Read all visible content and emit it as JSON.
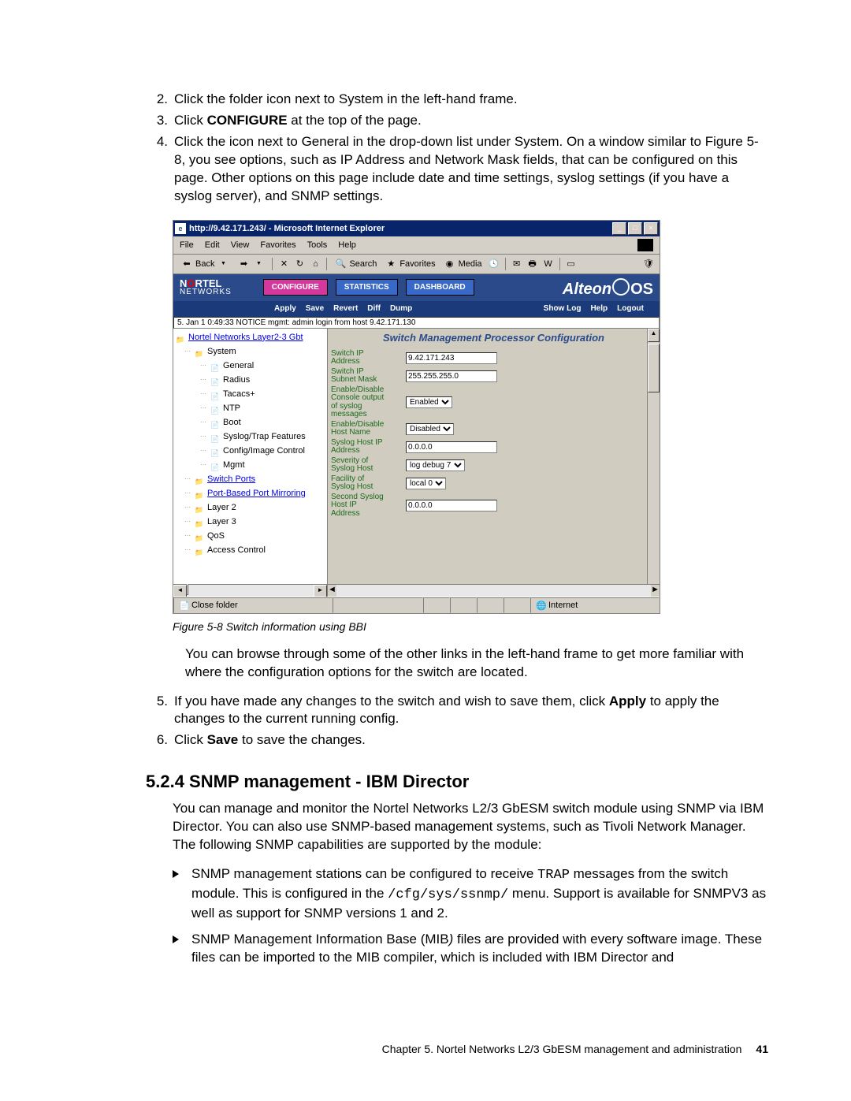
{
  "steps": {
    "s2": {
      "num": "2.",
      "txt": "Click the folder icon next to System in the left-hand frame."
    },
    "s3": {
      "num": "3.",
      "pre": "Click ",
      "bold": "CONFIGURE",
      "post": " at the top of the page."
    },
    "s4": {
      "num": "4.",
      "txt": "Click the icon next to General in the drop-down list under System. On a window similar to Figure 5-8, you see options, such as IP Address and Network Mask fields, that can be configured on this page. Other options on this page include date and time settings, syslog settings (if you have a syslog server), and SNMP settings."
    },
    "s5": {
      "num": "5.",
      "pre": "If you have made any changes to the switch and wish to save them, click ",
      "bold": "Apply",
      "post": " to apply the changes to the current running config."
    },
    "s6": {
      "num": "6.",
      "pre": "Click ",
      "bold": "Save",
      "post": " to save the changes."
    }
  },
  "browser": {
    "title": "http://9.42.171.243/ - Microsoft Internet Explorer",
    "menu": [
      "File",
      "Edit",
      "View",
      "Favorites",
      "Tools",
      "Help"
    ],
    "tool": {
      "back": "Back",
      "search": "Search",
      "fav": "Favorites",
      "media": "Media"
    },
    "status_left": "Close folder",
    "status_right": "Internet"
  },
  "app": {
    "brand1": "NORTEL",
    "brand2": "NETWORKS",
    "tabs": [
      "CONFIGURE",
      "STATISTICS",
      "DASHBOARD"
    ],
    "alteon": "Alteon",
    "os": "OS",
    "links": [
      "Apply",
      "Save",
      "Revert",
      "Diff",
      "Dump"
    ],
    "rlinks": [
      "Show Log",
      "Help",
      "Logout"
    ],
    "status": "5. Jan  1  0:49:33 NOTICE  mgmt: admin login from host 9.42.171.130"
  },
  "tree": {
    "root": "Nortel Networks Layer2-3 Gbt",
    "items": [
      {
        "ind": 12,
        "ico": "fld",
        "txt": "System",
        "style": "plain"
      },
      {
        "ind": 32,
        "ico": "doc",
        "txt": "General",
        "style": "plain"
      },
      {
        "ind": 32,
        "ico": "doc",
        "txt": "Radius",
        "style": "plain"
      },
      {
        "ind": 32,
        "ico": "doc",
        "txt": "Tacacs+",
        "style": "plain"
      },
      {
        "ind": 32,
        "ico": "doc",
        "txt": "NTP",
        "style": "plain"
      },
      {
        "ind": 32,
        "ico": "doc",
        "txt": "Boot",
        "style": "plain"
      },
      {
        "ind": 32,
        "ico": "doc",
        "txt": "Syslog/Trap Features",
        "style": "plain"
      },
      {
        "ind": 32,
        "ico": "doc",
        "txt": "Config/Image Control",
        "style": "plain"
      },
      {
        "ind": 32,
        "ico": "doc",
        "txt": "Mgmt",
        "style": "plain"
      },
      {
        "ind": 12,
        "ico": "fld",
        "txt": "Switch Ports",
        "style": "link"
      },
      {
        "ind": 12,
        "ico": "fld",
        "txt": "Port-Based Port Mirroring",
        "style": "link"
      },
      {
        "ind": 12,
        "ico": "fld",
        "txt": "Layer 2",
        "style": "plain"
      },
      {
        "ind": 12,
        "ico": "fld",
        "txt": "Layer 3",
        "style": "plain"
      },
      {
        "ind": 12,
        "ico": "fld",
        "txt": "QoS",
        "style": "plain"
      },
      {
        "ind": 12,
        "ico": "fld",
        "txt": "Access Control",
        "style": "plain"
      }
    ]
  },
  "panel": {
    "title": "Switch Management Processor Configuration",
    "rows": [
      {
        "label": "Switch IP\nAddress",
        "type": "text",
        "value": "9.42.171.243"
      },
      {
        "label": "Switch IP\nSubnet Mask",
        "type": "text",
        "value": "255.255.255.0"
      },
      {
        "label": "Enable/Disable\nConsole output\nof syslog\nmessages",
        "type": "select",
        "value": "Enabled"
      },
      {
        "label": "Enable/Disable\nHost Name",
        "type": "select",
        "value": "Disabled"
      },
      {
        "label": "Syslog Host IP\nAddress",
        "type": "text",
        "value": "0.0.0.0"
      },
      {
        "label": "Severity of\nSyslog Host",
        "type": "select",
        "value": "log debug 7"
      },
      {
        "label": "Facility of\nSyslog Host",
        "type": "select",
        "value": "local 0"
      },
      {
        "label": "Second Syslog\nHost IP\nAddress",
        "type": "text",
        "value": "0.0.0.0"
      }
    ]
  },
  "caption": "Figure 5-8   Switch information using BBI",
  "para1": "You can browse through some of the other links in the left-hand frame to get more familiar with where the configuration options for the switch are located.",
  "h2": "5.2.4  SNMP management - IBM Director",
  "para2": "You can manage and monitor the Nortel Networks L2/3 GbESM switch module using SNMP via IBM Director. You can also use SNMP-based management systems, such as Tivoli Network Manager. The following SNMP capabilities are supported by the module:",
  "bullets": {
    "b1": {
      "pre": "SNMP management stations can be configured to receive ",
      "mono1": "TRAP",
      "mid": " messages from the switch module. This is configured in the ",
      "mono2": "/cfg/sys/ssnmp/",
      "post": " menu. Support is available for SNMPV3 as well as support for SNMP versions 1 and 2."
    },
    "b2": {
      "pre": "SNMP Management Information Base (MIB",
      "ital": ")",
      "post": " files are provided with every software image. These files can be imported to the MIB compiler, which is included with IBM Director and"
    }
  },
  "footer": {
    "txt": "Chapter 5. Nortel Networks L2/3 GbESM management and administration",
    "pn": "41"
  }
}
